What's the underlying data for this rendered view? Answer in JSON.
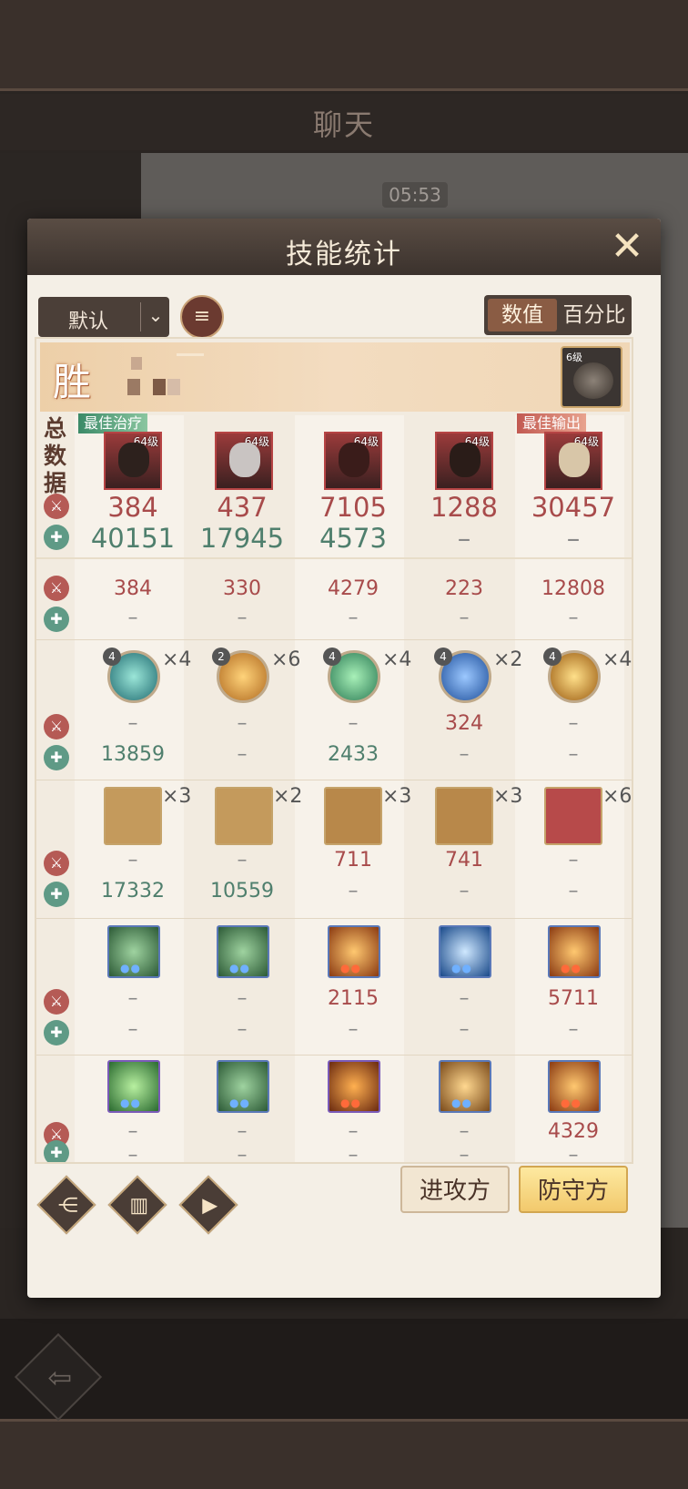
{
  "chat": {
    "title": "聊天",
    "time": "05:53"
  },
  "dialog": {
    "title": "技能统计",
    "sort_label": "默认",
    "toggle_on": "数值",
    "toggle_off": "百分比",
    "win_char": "胜",
    "enemy_level": "6级",
    "side_total": "总数据",
    "best_heal": "最佳治疗",
    "best_output": "最佳输出",
    "hero_level": "64级",
    "heroes": [
      {
        "dmg": "384",
        "heal": "40151"
      },
      {
        "dmg": "437",
        "heal": "17945"
      },
      {
        "dmg": "7105",
        "heal": "4573"
      },
      {
        "dmg": "1288",
        "heal": "–"
      },
      {
        "dmg": "30457",
        "heal": "–"
      }
    ],
    "row2": {
      "dmg": [
        "384",
        "330",
        "4279",
        "223",
        "12808"
      ],
      "heal": [
        "–",
        "–",
        "–",
        "–",
        "–"
      ]
    },
    "skills": {
      "levels": [
        "4",
        "2",
        "4",
        "4",
        "4"
      ],
      "mults": [
        "×4",
        "×6",
        "×4",
        "×2",
        "×4"
      ],
      "dmg": [
        "–",
        "–",
        "–",
        "324",
        "–"
      ],
      "heal": [
        "13859",
        "–",
        "2433",
        "–",
        "–"
      ]
    },
    "items": {
      "mults": [
        "×3",
        "×2",
        "×3",
        "×3",
        "×6"
      ],
      "dmg": [
        "–",
        "–",
        "711",
        "741",
        "–"
      ],
      "heal": [
        "17332",
        "10559",
        "–",
        "–",
        "–"
      ]
    },
    "runes1": {
      "dmg": [
        "–",
        "–",
        "2115",
        "–",
        "5711"
      ],
      "heal": [
        "–",
        "–",
        "–",
        "–",
        "–"
      ]
    },
    "runes2": {
      "dmg": [
        "–",
        "–",
        "–",
        "–",
        "4329"
      ],
      "heal": [
        "–",
        "–",
        "–",
        "–",
        "–"
      ]
    },
    "attack_label": "进攻方",
    "defend_label": "防守方"
  }
}
